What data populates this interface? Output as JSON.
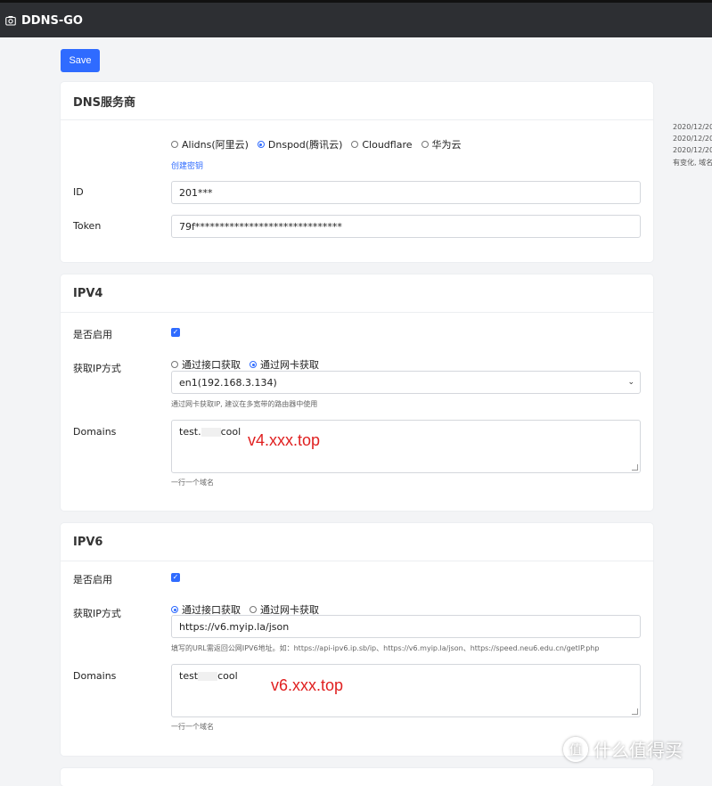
{
  "app": {
    "title": "DDNS-GO"
  },
  "toolbar": {
    "save_label": "Save"
  },
  "dns": {
    "title": "DNS服务商",
    "providers": [
      {
        "label": "Alidns(阿里云)",
        "selected": false
      },
      {
        "label": "Dnspod(腾讯云)",
        "selected": true
      },
      {
        "label": "Cloudflare",
        "selected": false
      },
      {
        "label": "华为云",
        "selected": false
      }
    ],
    "create_key_link": "创建密钥",
    "id_label": "ID",
    "id_value": "201***",
    "token_label": "Token",
    "token_value": "79f******************************"
  },
  "ipv4": {
    "title": "IPV4",
    "enable_label": "是否启用",
    "enabled": true,
    "method_label": "获取IP方式",
    "methods": [
      {
        "label": "通过接口获取",
        "selected": false
      },
      {
        "label": "通过网卡获取",
        "selected": true
      }
    ],
    "interface_value": "en1(192.168.3.134)",
    "interface_help": "通过网卡获取IP, 建议在多宽带的路由器中使用",
    "domains_label": "Domains",
    "domains_value_prefix": "test.",
    "domains_value_suffix": "cool",
    "domains_overlay": "v4.xxx.top",
    "domains_help": "一行一个域名"
  },
  "ipv6": {
    "title": "IPV6",
    "enable_label": "是否启用",
    "enabled": true,
    "method_label": "获取IP方式",
    "methods": [
      {
        "label": "通过接口获取",
        "selected": true
      },
      {
        "label": "通过网卡获取",
        "selected": false
      }
    ],
    "url_value": "https://v6.myip.la/json",
    "url_help": "填写的URL需返回公网IPV6地址。如：https://api-ipv6.ip.sb/ip、https://v6.myip.la/json、https://speed.neu6.edu.cn/getIP.php",
    "domains_label": "Domains",
    "domains_value_prefix": "test",
    "domains_value_suffix": "cool",
    "domains_overlay": "v6.xxx.top",
    "domains_help": "一行一个域名"
  },
  "logs": [
    "2020/12/20",
    "2020/12/20",
    "2020/12/20",
    "有变化, 域名"
  ],
  "watermark": {
    "text": "什么值得买",
    "logo_glyph": "值"
  },
  "colors": {
    "accent": "#2f6bff",
    "topbar": "#2d2f33",
    "overlay_red": "#e02020"
  }
}
